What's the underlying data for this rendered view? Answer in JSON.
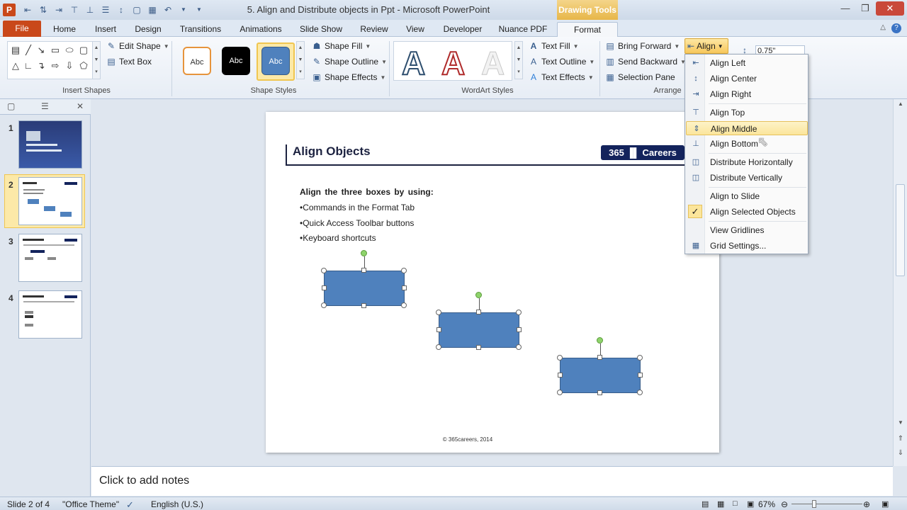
{
  "window": {
    "title": "5. Align and Distribute objects in Ppt  -  Microsoft PowerPoint",
    "app_icon": "P",
    "context_tab": "Drawing Tools"
  },
  "tabs": [
    "File",
    "Home",
    "Insert",
    "Design",
    "Transitions",
    "Animations",
    "Slide Show",
    "Review",
    "View",
    "Developer",
    "Nuance PDF",
    "Format"
  ],
  "ribbon": {
    "insert_shapes": {
      "label": "Insert Shapes",
      "edit_shape": "Edit Shape",
      "text_box": "Text Box"
    },
    "shape_styles": {
      "label": "Shape Styles",
      "abc": "Abc",
      "shape_fill": "Shape Fill",
      "shape_outline": "Shape Outline",
      "shape_effects": "Shape Effects"
    },
    "wordart": {
      "label": "WordArt Styles",
      "letter": "A",
      "text_fill": "Text Fill",
      "text_outline": "Text Outline",
      "text_effects": "Text Effects"
    },
    "arrange": {
      "label": "Arrange",
      "bring_forward": "Bring Forward",
      "send_backward": "Send Backward",
      "selection_pane": "Selection Pane",
      "align": "Align"
    },
    "size": {
      "height": "0.75\""
    }
  },
  "slides_panel": {
    "numbers": [
      "1",
      "2",
      "3",
      "4"
    ],
    "selected": 2
  },
  "slide": {
    "title": "Align Objects",
    "brand": "365 ▐▌ Careers",
    "instruction": "Align the three boxes by using:",
    "bullets": [
      "•Commands in the Format Tab",
      "•Quick Access Toolbar buttons",
      "•Keyboard shortcuts"
    ],
    "footer": "© 365careers, 2014"
  },
  "align_menu": {
    "items": [
      {
        "label": "Align Left",
        "icon": "align-left-icon"
      },
      {
        "label": "Align Center",
        "icon": "align-center-icon"
      },
      {
        "label": "Align Right",
        "icon": "align-right-icon"
      },
      {
        "label": "Align Top",
        "icon": "align-top-icon"
      },
      {
        "label": "Align Middle",
        "icon": "align-middle-icon"
      },
      {
        "label": "Align Bottom",
        "icon": "align-bottom-icon"
      },
      {
        "label": "Distribute Horizontally",
        "icon": "distribute-horizontally-icon"
      },
      {
        "label": "Distribute Vertically",
        "icon": "distribute-vertically-icon"
      },
      {
        "label": "Align to Slide",
        "icon": ""
      },
      {
        "label": "Align Selected Objects",
        "icon": "checkmark-icon",
        "checked": true
      },
      {
        "label": "View Gridlines",
        "icon": ""
      },
      {
        "label": "Grid Settings...",
        "icon": "grid-icon"
      }
    ],
    "highlighted": "Align Middle"
  },
  "notes": {
    "placeholder": "Click to add notes"
  },
  "status": {
    "slide": "Slide 2 of 4",
    "theme": "\"Office Theme\"",
    "language": "English (U.S.)",
    "zoom": "67%"
  },
  "colors": {
    "file_tab": "#c9481a",
    "context_tab": "#e7b648",
    "box_fill": "#4f81bd",
    "brand_bg": "#13235c",
    "highlight": "#fbe59b"
  }
}
